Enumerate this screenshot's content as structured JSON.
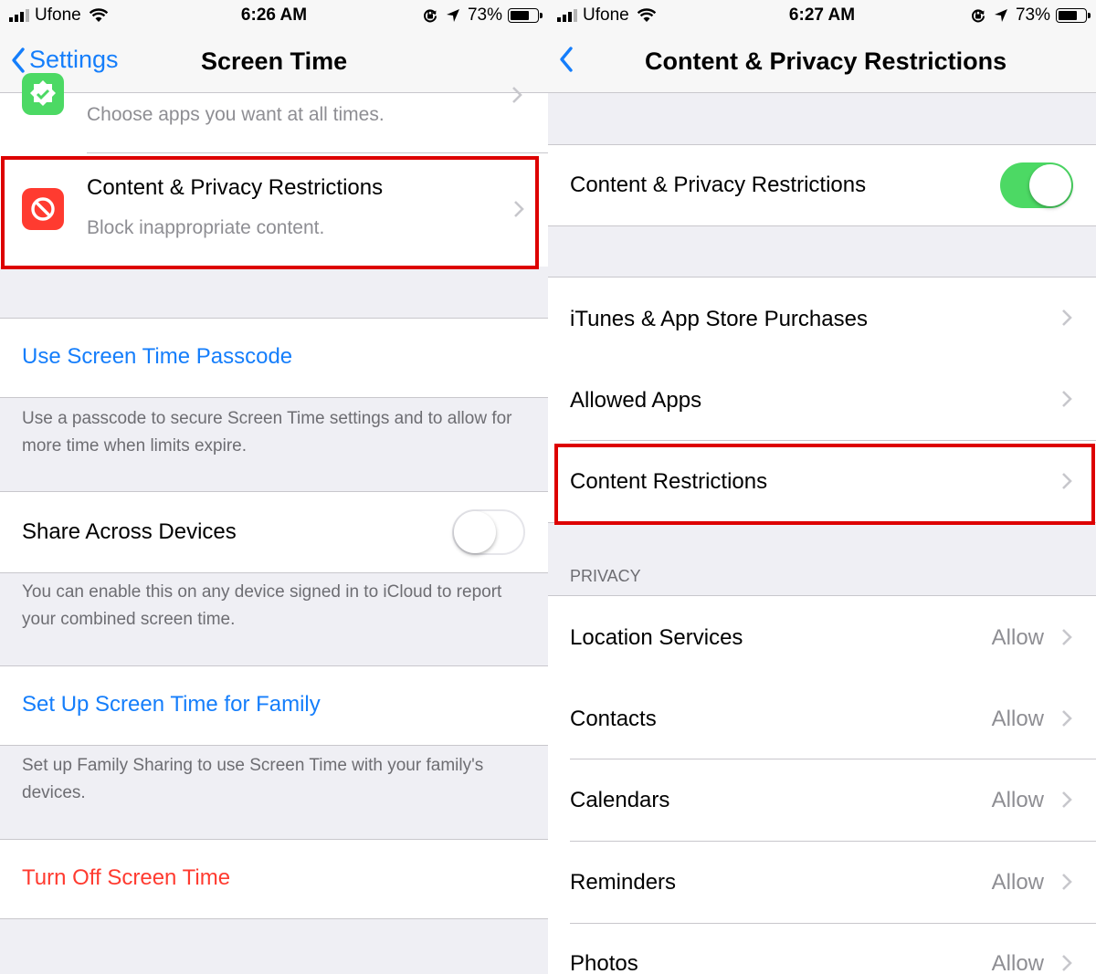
{
  "left": {
    "status": {
      "carrier": "Ufone",
      "time": "6:26 AM",
      "battery": "73%",
      "battery_level": 0.73
    },
    "nav": {
      "back_label": "Settings",
      "title": "Screen Time"
    },
    "always_allowed": {
      "subtitle": "Choose apps you want at all times."
    },
    "content_privacy": {
      "title": "Content & Privacy Restrictions",
      "subtitle": "Block inappropriate content."
    },
    "passcode": {
      "label": "Use Screen Time Passcode",
      "footer": "Use a passcode to secure Screen Time settings and to allow for more time when limits expire."
    },
    "share": {
      "label": "Share Across Devices",
      "enabled": false,
      "footer": "You can enable this on any device signed in to iCloud to report your combined screen time."
    },
    "family": {
      "label": "Set Up Screen Time for Family",
      "footer": "Set up Family Sharing to use Screen Time with your family's devices."
    },
    "turn_off": {
      "label": "Turn Off Screen Time"
    }
  },
  "right": {
    "status": {
      "carrier": "Ufone",
      "time": "6:27 AM",
      "battery": "73%",
      "battery_level": 0.73
    },
    "nav": {
      "title": "Content & Privacy Restrictions"
    },
    "toggle_row": {
      "label": "Content & Privacy Restrictions",
      "enabled": true
    },
    "menu": [
      {
        "label": "iTunes & App Store Purchases"
      },
      {
        "label": "Allowed Apps"
      },
      {
        "label": "Content Restrictions"
      }
    ],
    "privacy_header": "PRIVACY",
    "privacy": [
      {
        "label": "Location Services",
        "value": "Allow"
      },
      {
        "label": "Contacts",
        "value": "Allow"
      },
      {
        "label": "Calendars",
        "value": "Allow"
      },
      {
        "label": "Reminders",
        "value": "Allow"
      },
      {
        "label": "Photos",
        "value": "Allow"
      }
    ]
  },
  "colors": {
    "tint": "#157efb",
    "destructive": "#ff3b30",
    "switch_on": "#4cd964",
    "highlight": "#dd0000",
    "secondary_text": "#8e8e93"
  }
}
